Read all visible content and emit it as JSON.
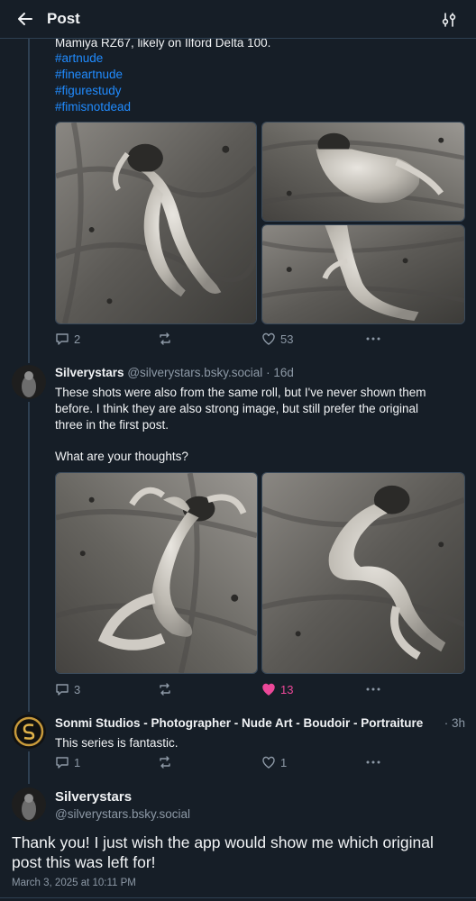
{
  "header": {
    "title": "Post"
  },
  "post1": {
    "camera_line": "Mamiya RZ67, likely on Ilford Delta 100.",
    "hashtags": [
      "#artnude",
      "#fineartnude",
      "#figurestudy",
      "#fimisnotdead"
    ],
    "replies": "2",
    "likes": "53"
  },
  "post2": {
    "author": "Silverystars",
    "handle": "@silverystars.bsky.social",
    "time": "· 16d",
    "text_lines": [
      "These shots were also from the same roll, but I've never shown them",
      "before. I think they are also strong image, but still prefer the original",
      "three in the first post."
    ],
    "question": "What are your thoughts?",
    "replies": "3",
    "likes": "13"
  },
  "post3": {
    "author": "Sonmi Studios - Photographer - Nude Art - Boudoir - Portraiture ...",
    "time": "· 3h",
    "text": "This series is fantastic.",
    "replies": "1",
    "likes": "1"
  },
  "main_post": {
    "author": "Silverystars",
    "handle": "@silverystars.bsky.social",
    "text": "Thank you! I just wish the app would show me which original post this was left for!",
    "timestamp": "March 3, 2025 at 10:11 PM"
  },
  "colors": {
    "background": "#161e27",
    "link": "#208bfe",
    "muted": "#8d99a6",
    "liked": "#ec4899",
    "divider": "#2e4052"
  },
  "icons": [
    "back-arrow-icon",
    "sliders-icon",
    "reply-icon",
    "repost-icon",
    "heart-icon",
    "more-icon"
  ]
}
